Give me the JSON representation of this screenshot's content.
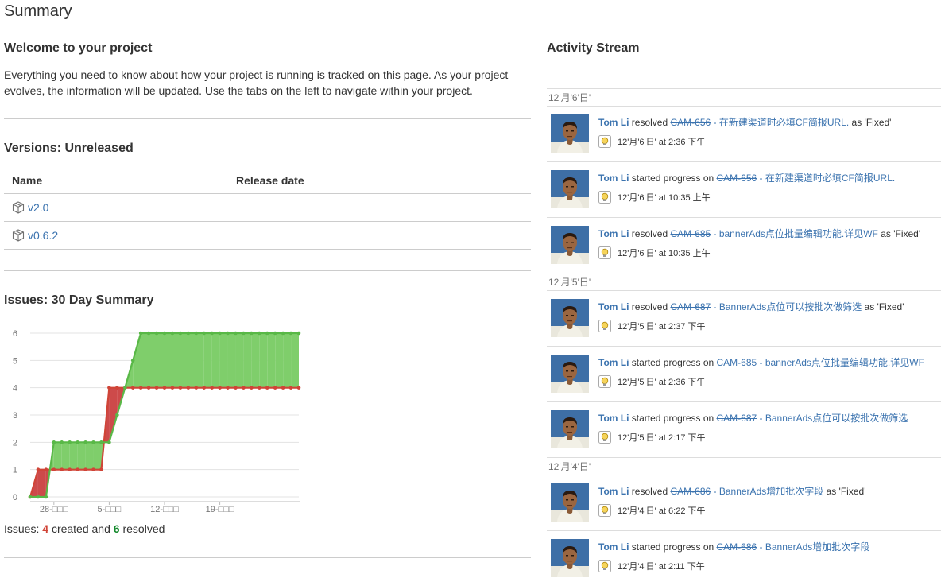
{
  "page": {
    "title": "Summary"
  },
  "welcome": {
    "title": "Welcome to your project",
    "text": "Everything you need to know about how your project is running is tracked on this page. As your project evolves, the information will be updated. Use the tabs on the left to navigate within your project."
  },
  "versions": {
    "title": "Versions: Unreleased",
    "col_name": "Name",
    "col_release": "Release date",
    "items": [
      {
        "name": "v2.0",
        "icon": "package-icon"
      },
      {
        "name": "v0.6.2",
        "icon": "package-icon"
      }
    ]
  },
  "issues": {
    "title": "Issues: 30 Day Summary",
    "summary_prefix": "Issues:",
    "created": "4",
    "created_text": "created and",
    "resolved": "6",
    "resolved_text": "resolved"
  },
  "chart_data": {
    "type": "area",
    "title": "",
    "xlabel": "",
    "ylabel": "",
    "ylim": [
      0,
      6
    ],
    "y_ticks": [
      "0",
      "1",
      "2",
      "3",
      "4",
      "5",
      "6"
    ],
    "x_ticks": [
      "28-□□□",
      "5-□□□",
      "12-□□□",
      "19-□□□"
    ],
    "x_tick_index": [
      3,
      10,
      17,
      24
    ],
    "series": [
      {
        "color": "#d04437",
        "values": [
          0,
          1,
          1,
          1,
          1,
          1,
          1,
          1,
          1,
          1,
          4,
          4,
          4,
          4,
          4,
          4,
          4,
          4,
          4,
          4,
          4,
          4,
          4,
          4,
          4,
          4,
          4,
          4,
          4,
          4,
          4,
          4,
          4,
          4,
          4
        ]
      },
      {
        "color": "#59b847",
        "values": [
          0,
          0,
          0,
          2,
          2,
          2,
          2,
          2,
          2,
          2,
          2,
          3,
          4,
          5,
          6,
          6,
          6,
          6,
          6,
          6,
          6,
          6,
          6,
          6,
          6,
          6,
          6,
          6,
          6,
          6,
          6,
          6,
          6,
          6,
          6
        ]
      }
    ],
    "grid": true,
    "colors": {
      "created": "#d04437",
      "resolved": "#59b847",
      "area_created": "#cd4a4a",
      "area_resolved": "#7fce6b"
    }
  },
  "activity": {
    "title": "Activity Stream",
    "days": [
      {
        "date": "12'月'6'日'",
        "items": [
          {
            "user": "Tom Li",
            "action": "resolved",
            "key": "CAM-656",
            "summary": " - 在新建渠道时必填CF简报URL.",
            "suffix": " as 'Fixed'",
            "time": "12'月'6'日' at 2:36 下午"
          },
          {
            "user": "Tom Li",
            "action": "started progress on",
            "key": "CAM-656",
            "summary": " - 在新建渠道时必填CF简报URL.",
            "suffix": "",
            "time": "12'月'6'日' at 10:35 上午"
          },
          {
            "user": "Tom Li",
            "action": "resolved",
            "key": "CAM-685",
            "summary": " - bannerAds点位批量编辑功能.详见WF",
            "suffix": " as 'Fixed'",
            "time": "12'月'6'日' at 10:35 上午"
          }
        ]
      },
      {
        "date": "12'月'5'日'",
        "items": [
          {
            "user": "Tom Li",
            "action": "resolved",
            "key": "CAM-687",
            "summary": " - BannerAds点位可以按批次做筛选",
            "suffix": " as 'Fixed'",
            "time": "12'月'5'日' at 2:37 下午"
          },
          {
            "user": "Tom Li",
            "action": "started progress on",
            "key": "CAM-685",
            "summary": " - bannerAds点位批量编辑功能.详见WF",
            "suffix": "",
            "time": "12'月'5'日' at 2:36 下午"
          },
          {
            "user": "Tom Li",
            "action": "started progress on",
            "key": "CAM-687",
            "summary": " - BannerAds点位可以按批次做筛选",
            "suffix": "",
            "time": "12'月'5'日' at 2:17 下午"
          }
        ]
      },
      {
        "date": "12'月'4'日'",
        "items": [
          {
            "user": "Tom Li",
            "action": "resolved",
            "key": "CAM-686",
            "summary": " - BannerAds增加批次字段",
            "suffix": " as 'Fixed'",
            "time": "12'月'4'日' at 6:22 下午"
          },
          {
            "user": "Tom Li",
            "action": "started progress on",
            "key": "CAM-686",
            "summary": " - BannerAds增加批次字段",
            "suffix": "",
            "time": "12'月'4'日' at 2:11 下午"
          }
        ]
      }
    ]
  }
}
